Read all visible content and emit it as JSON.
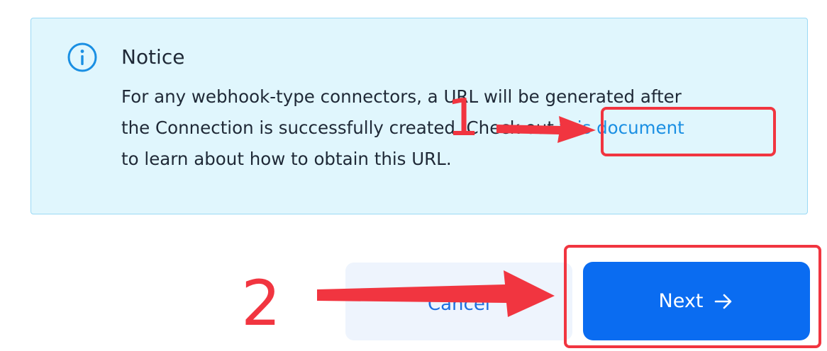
{
  "notice": {
    "title": "Notice",
    "icon": "info-icon",
    "body_line_1": "For any webhook-type connectors, a URL will be generated after",
    "body_line_2_before_link": "the Connection is successfully created. Check out ",
    "link_text": "this document",
    "body_line_3": "to learn about how to obtain this URL."
  },
  "actions": {
    "cancel_label": "Cancel",
    "next_label": "Next",
    "next_icon": "arrow-right-icon"
  },
  "annotations": {
    "step_1": "1",
    "step_2": "2",
    "accent_color": "#f13540"
  },
  "colors": {
    "notice_background": "#e0f6fd",
    "link": "#1a8fe3",
    "primary_button": "#0a6cf1"
  }
}
